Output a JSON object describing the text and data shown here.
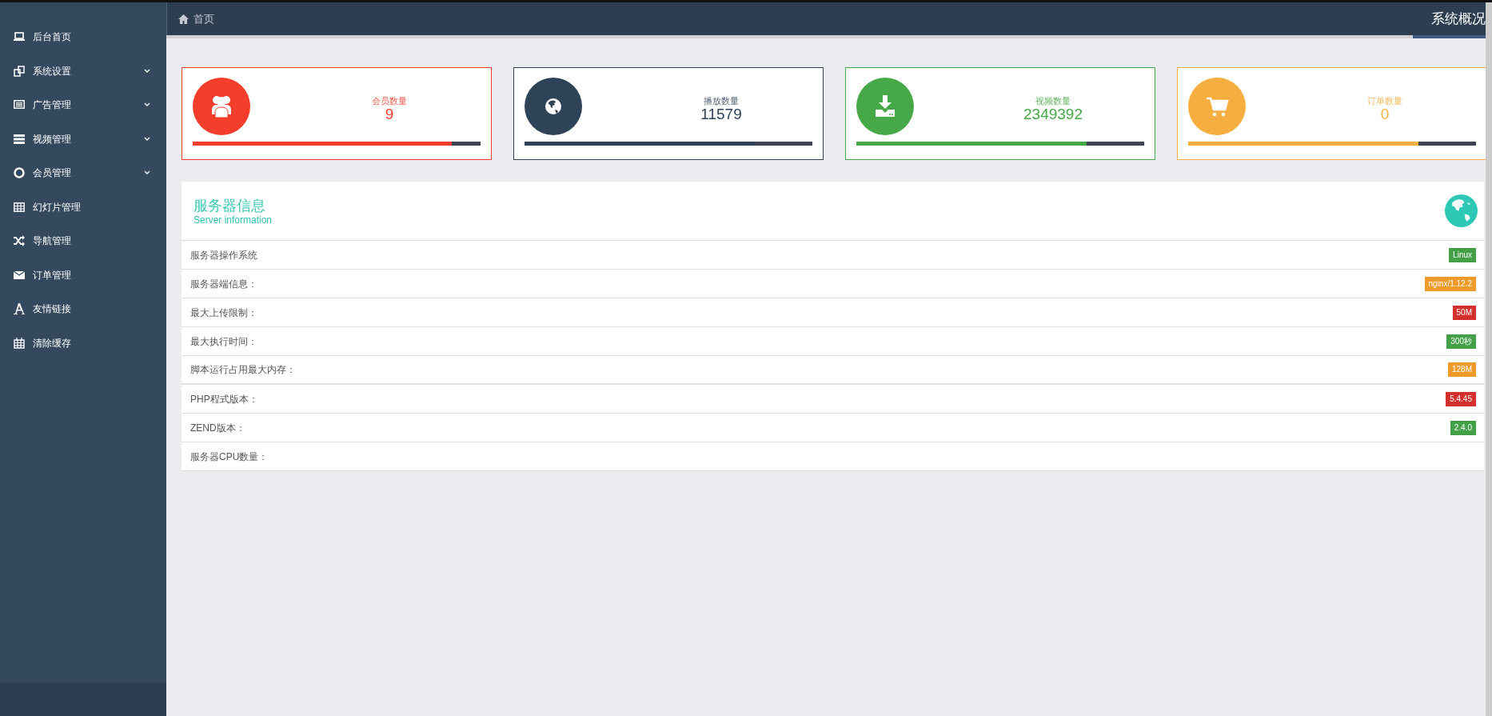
{
  "sidebar": {
    "items": [
      {
        "label": "后台首页",
        "expandable": false
      },
      {
        "label": "系统设置",
        "expandable": true
      },
      {
        "label": "广告管理",
        "expandable": true
      },
      {
        "label": "视频管理",
        "expandable": true
      },
      {
        "label": "会员管理",
        "expandable": true
      },
      {
        "label": "幻灯片管理",
        "expandable": false
      },
      {
        "label": "导航管理",
        "expandable": false
      },
      {
        "label": "订单管理",
        "expandable": false
      },
      {
        "label": "友情链接",
        "expandable": false
      },
      {
        "label": "清除缓存",
        "expandable": false
      }
    ]
  },
  "header": {
    "breadcrumb": "首页",
    "title": "系统概况"
  },
  "stat_cards": [
    {
      "label": "会员数量",
      "value": "9",
      "color": "#f43d2a",
      "level": 0.9
    },
    {
      "label": "播放数量",
      "value": "11579",
      "color": "#2f4358",
      "level": 0.8
    },
    {
      "label": "视频数量",
      "value": "2349392",
      "color": "#47a847",
      "level": 0.8
    },
    {
      "label": "订单数量",
      "value": "0",
      "color": "#f7ae41",
      "level": 0.8
    }
  ],
  "server_info": {
    "title": "服务器信息",
    "subtitle": "Server information",
    "rows": [
      {
        "label": "服务器操作系统",
        "badge": "Linux",
        "color": "#43a047"
      },
      {
        "label": "服务器端信息：",
        "badge": "nginx/1.12.2",
        "color": "#ef9b29"
      },
      {
        "label": "最大上传限制：",
        "badge": "50M",
        "color": "#d32f2f"
      },
      {
        "label": "最大执行时间：",
        "badge": "300秒",
        "color": "#43a047"
      },
      {
        "label": "脚本运行占用最大内存：",
        "badge": "128M",
        "color": "#ef9b29"
      },
      {
        "label": "PHP程式版本：",
        "badge": "5.4.45",
        "color": "#d32f2f"
      },
      {
        "label": "ZEND版本：",
        "badge": "2.4.0",
        "color": "#43a047"
      },
      {
        "label": "服务器CPU数量："
      }
    ]
  }
}
